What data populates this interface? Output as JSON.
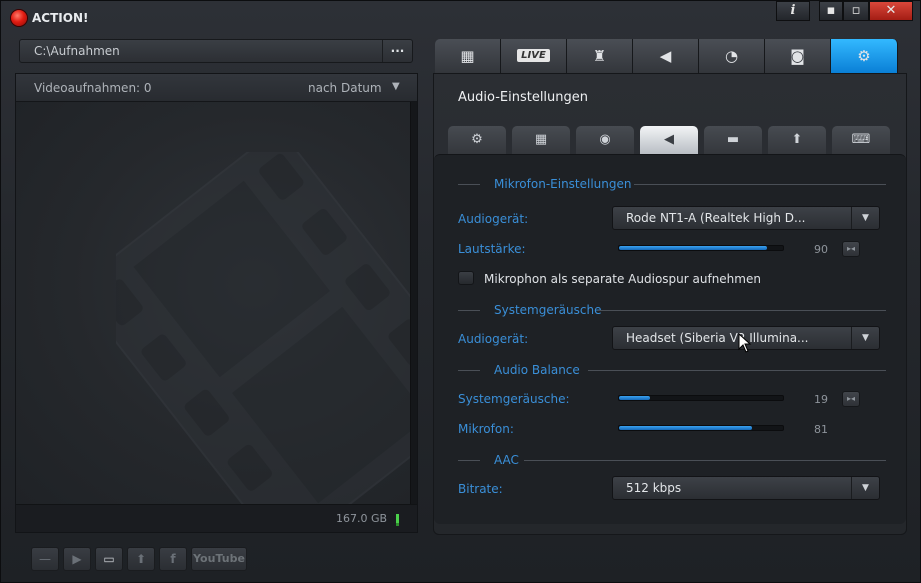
{
  "window": {
    "title": "ACTION!",
    "info_label": "i",
    "minimize_label": "▪",
    "maximize_label": "▫",
    "close_label": "✕"
  },
  "left": {
    "path": "C:\\Aufnahmen",
    "browse_label": "...",
    "video_count": "Videoaufnahmen: 0",
    "sort_label": "nach Datum",
    "sort_arrow": "▼",
    "disk_space": "167.0 GB"
  },
  "bottom_toolbar": {
    "buttons": [
      {
        "name": "delete-button",
        "glyph": "—"
      },
      {
        "name": "play-button",
        "glyph": "▶"
      },
      {
        "name": "open-folder-button",
        "glyph": "▭"
      },
      {
        "name": "upload-button",
        "glyph": "⬆"
      },
      {
        "name": "facebook-button",
        "glyph": "f"
      }
    ],
    "youtube_label": "YouTube"
  },
  "tabs": [
    {
      "name": "tab-video",
      "icon": "film-icon",
      "glyph": "▦"
    },
    {
      "name": "tab-live",
      "icon": "live-icon",
      "glyph": "LIVE"
    },
    {
      "name": "tab-gameplay",
      "icon": "controller-icon",
      "glyph": "♜"
    },
    {
      "name": "tab-audio",
      "icon": "speaker-icon",
      "glyph": "◀"
    },
    {
      "name": "tab-benchmark",
      "icon": "stopwatch-icon",
      "glyph": "◔"
    },
    {
      "name": "tab-screenshot",
      "icon": "camera-icon",
      "glyph": "◙"
    },
    {
      "name": "tab-settings",
      "icon": "gear-icon",
      "glyph": "⚙",
      "active": true
    }
  ],
  "panel": {
    "title": "Audio-Einstellungen",
    "subtabs": [
      {
        "name": "subtab-general",
        "icon": "gear-icon",
        "glyph": "⚙"
      },
      {
        "name": "subtab-video",
        "icon": "film-icon",
        "glyph": "▦"
      },
      {
        "name": "subtab-webcam",
        "icon": "webcam-icon",
        "glyph": "◉"
      },
      {
        "name": "subtab-audio",
        "icon": "speaker-icon",
        "glyph": "◀",
        "active": true
      },
      {
        "name": "subtab-display",
        "icon": "monitor-icon",
        "glyph": "▬"
      },
      {
        "name": "subtab-upload",
        "icon": "upload-icon",
        "glyph": "⬆"
      },
      {
        "name": "subtab-hotkeys",
        "icon": "keyboard-icon",
        "glyph": "⌨"
      }
    ]
  },
  "mic": {
    "header": "Mikrofon-Einstellungen",
    "device_label": "Audiogerät:",
    "device_value": "Rode NT1-A (Realtek High D...",
    "volume_label": "Lautstärke:",
    "volume": 90,
    "separate_track_label": "Mikrophon als separate Audiospur aufnehmen"
  },
  "system": {
    "header": "Systemgeräusche",
    "device_label": "Audiogerät:",
    "device_value": "Headset (Siberia V2 Illumina..."
  },
  "balance": {
    "header": "Audio Balance",
    "system_label": "Systemgeräusche:",
    "system_value": 19,
    "mic_label": "Mikrofon:",
    "mic_value": 81
  },
  "aac": {
    "header": "AAC",
    "bitrate_label": "Bitrate:",
    "bitrate_value": "512 kbps"
  },
  "colors": {
    "accent": "#1a8fe6",
    "label_blue": "#3a8fd8",
    "close_red": "#c4362b"
  }
}
